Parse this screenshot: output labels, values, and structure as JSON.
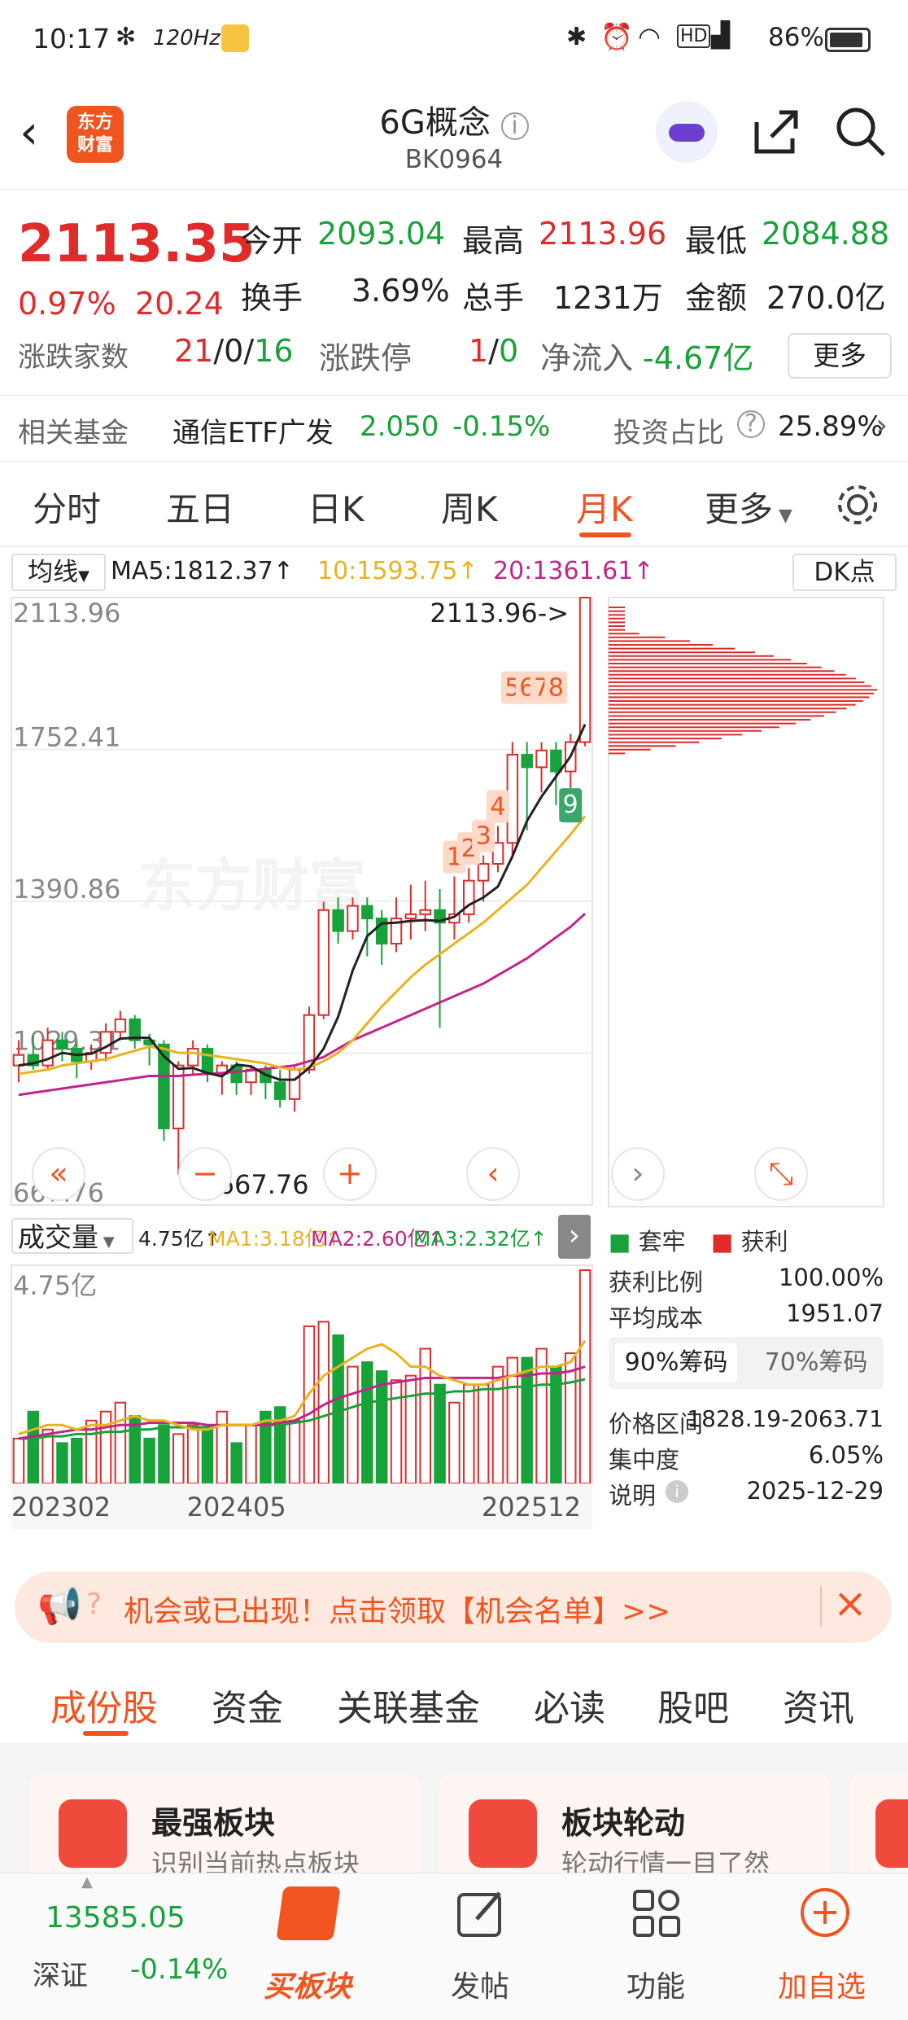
{
  "status_bar": {
    "time": "10:17",
    "extra": "120Hz",
    "battery": "86%"
  },
  "header": {
    "title": "6G概念",
    "code": "BK0964",
    "logo_line1": "东方",
    "logo_line2": "财富"
  },
  "quote": {
    "price": "2113.35",
    "change_pct": "0.97%",
    "change": "20.24",
    "open_label": "今开",
    "open": "2093.04",
    "high_label": "最高",
    "high": "2113.96",
    "low_label": "最低",
    "low": "2084.88",
    "turnover_label": "换手",
    "turnover": "3.69%",
    "volume_label": "总手",
    "volume": "1231万",
    "amount_label": "金额",
    "amount": "270.0亿",
    "updown_label": "涨跌家数",
    "up": "21",
    "flat": "0",
    "down": "16",
    "limit_label": "涨跌停",
    "limit_up": "1",
    "limit_down": "0",
    "netflow_label": "净流入",
    "netflow": "-4.67亿",
    "more": "更多"
  },
  "fund": {
    "label": "相关基金",
    "name": "通信ETF广发",
    "price": "2.050",
    "pct": "-0.15%",
    "ratio_label": "投资占比",
    "ratio": "25.89%"
  },
  "tabs": [
    "分时",
    "五日",
    "日K",
    "周K",
    "月K",
    "更多"
  ],
  "active_tab": "月K",
  "ma_line": {
    "type": "均线",
    "ma5": "MA5:1812.37",
    "ma10": "10:1593.75",
    "ma20": "20:1361.61",
    "dk": "DK点"
  },
  "colors": {
    "up": "#e02b2b",
    "down": "#18a23a",
    "ma5": "#222222",
    "ma10": "#e8b31e",
    "ma20": "#c2258a",
    "accent": "#f0541f"
  },
  "chart_data": {
    "type": "candlestick",
    "y_ticks": [
      "2113.96",
      "1752.41",
      "1390.86",
      "1029.31",
      "667.76"
    ],
    "ylim": [
      667.76,
      2113.96
    ],
    "max_label": "2113.96->",
    "min_label": "<-667.76",
    "markers": [
      "1",
      "2",
      "3",
      "4",
      "5",
      "6",
      "7",
      "8",
      "9"
    ],
    "x_ticks": [
      "202302",
      "202405",
      "202512"
    ],
    "candles": [
      [
        1000,
        1025,
        960,
        1060
      ],
      [
        1025,
        1000,
        990,
        1070
      ],
      [
        1000,
        1060,
        990,
        1090
      ],
      [
        1060,
        1040,
        1010,
        1080
      ],
      [
        1040,
        1010,
        970,
        1055
      ],
      [
        1010,
        1030,
        990,
        1050
      ],
      [
        1030,
        1080,
        1010,
        1100
      ],
      [
        1080,
        1110,
        1060,
        1130
      ],
      [
        1110,
        1060,
        1040,
        1120
      ],
      [
        1060,
        1050,
        1000,
        1075
      ],
      [
        1050,
        850,
        820,
        1060
      ],
      [
        850,
        1000,
        740,
        1010
      ],
      [
        1000,
        1040,
        980,
        1060
      ],
      [
        1040,
        980,
        960,
        1050
      ],
      [
        980,
        1000,
        930,
        1010
      ],
      [
        1000,
        960,
        930,
        1010
      ],
      [
        960,
        990,
        930,
        1000
      ],
      [
        990,
        960,
        920,
        1000
      ],
      [
        960,
        920,
        900,
        990
      ],
      [
        920,
        990,
        890,
        1000
      ],
      [
        990,
        1120,
        980,
        1140
      ],
      [
        1120,
        1370,
        1110,
        1390
      ],
      [
        1370,
        1320,
        1290,
        1400
      ],
      [
        1320,
        1380,
        1300,
        1400
      ],
      [
        1380,
        1350,
        1260,
        1400
      ],
      [
        1350,
        1290,
        1240,
        1370
      ],
      [
        1290,
        1350,
        1270,
        1400
      ],
      [
        1350,
        1360,
        1300,
        1430
      ],
      [
        1360,
        1370,
        1320,
        1440
      ],
      [
        1370,
        1340,
        1090,
        1420
      ],
      [
        1340,
        1360,
        1300,
        1450
      ],
      [
        1360,
        1440,
        1340,
        1470
      ],
      [
        1440,
        1480,
        1390,
        1500
      ],
      [
        1480,
        1530,
        1460,
        1570
      ],
      [
        1530,
        1740,
        1500,
        1770
      ],
      [
        1740,
        1710,
        1560,
        1770
      ],
      [
        1710,
        1750,
        1650,
        1770
      ],
      [
        1750,
        1700,
        1620,
        1770
      ],
      [
        1700,
        1770,
        1660,
        1790
      ],
      [
        1770,
        2113.96,
        1760,
        2113.96
      ]
    ],
    "ma5": [
      1000,
      1005,
      1015,
      1030,
      1025,
      1028,
      1044,
      1064,
      1066,
      1066,
      1022,
      992,
      994,
      982,
      974,
      1002,
      998,
      978,
      966,
      966,
      994,
      1040,
      1116,
      1226,
      1308,
      1338,
      1340,
      1344,
      1346,
      1344,
      1354,
      1382,
      1400,
      1426,
      1498,
      1582,
      1640,
      1688,
      1736,
      1812.37
    ],
    "ma10": [
      980,
      985,
      990,
      1000,
      1005,
      1010,
      1015,
      1025,
      1035,
      1045,
      1040,
      1030,
      1030,
      1025,
      1020,
      1015,
      1010,
      1005,
      995,
      990,
      995,
      1010,
      1030,
      1060,
      1100,
      1140,
      1175,
      1210,
      1240,
      1265,
      1290,
      1315,
      1340,
      1370,
      1400,
      1430,
      1470,
      1510,
      1550,
      1593.75
    ],
    "ma20": [
      930,
      935,
      940,
      945,
      950,
      955,
      960,
      965,
      970,
      975,
      975,
      975,
      978,
      980,
      982,
      985,
      988,
      992,
      996,
      1000,
      1010,
      1020,
      1040,
      1060,
      1075,
      1090,
      1105,
      1120,
      1135,
      1150,
      1165,
      1180,
      1195,
      1215,
      1235,
      1255,
      1280,
      1305,
      1330,
      1361.61
    ],
    "volume": {
      "label": "成交量",
      "max_label": "4.75亿",
      "ma_texts": [
        "4.75亿",
        "MA1:3.18亿",
        "MA2:2.60亿",
        "MA3:2.32亿"
      ],
      "values": [
        1.0,
        1.6,
        1.2,
        0.9,
        1.0,
        1.4,
        1.6,
        1.8,
        1.5,
        1.0,
        1.3,
        1.1,
        1.3,
        1.2,
        1.6,
        0.9,
        1.3,
        1.6,
        1.7,
        1.4,
        3.5,
        3.6,
        3.3,
        2.6,
        2.7,
        2.5,
        2.3,
        2.4,
        3.0,
        2.2,
        1.8,
        2.2,
        2.2,
        2.6,
        2.8,
        2.8,
        3.0,
        2.6,
        2.9,
        4.75
      ],
      "ma1": [
        1.1,
        1.2,
        1.3,
        1.3,
        1.2,
        1.3,
        1.3,
        1.4,
        1.5,
        1.4,
        1.4,
        1.3,
        1.2,
        1.2,
        1.3,
        1.3,
        1.3,
        1.4,
        1.4,
        1.5,
        2.0,
        2.4,
        2.6,
        2.8,
        3.0,
        3.1,
        2.9,
        2.6,
        2.6,
        2.4,
        2.3,
        2.2,
        2.2,
        2.3,
        2.4,
        2.5,
        2.6,
        2.6,
        2.7,
        3.18
      ],
      "ma2": [
        1.0,
        1.05,
        1.1,
        1.15,
        1.2,
        1.2,
        1.25,
        1.3,
        1.3,
        1.35,
        1.35,
        1.35,
        1.35,
        1.3,
        1.3,
        1.3,
        1.3,
        1.3,
        1.35,
        1.4,
        1.55,
        1.75,
        1.9,
        2.0,
        2.1,
        2.2,
        2.25,
        2.3,
        2.35,
        2.35,
        2.35,
        2.35,
        2.35,
        2.35,
        2.4,
        2.4,
        2.45,
        2.45,
        2.5,
        2.6
      ],
      "ma3": [
        1.0,
        1.0,
        1.05,
        1.05,
        1.1,
        1.1,
        1.15,
        1.15,
        1.2,
        1.2,
        1.25,
        1.25,
        1.25,
        1.25,
        1.3,
        1.3,
        1.3,
        1.3,
        1.3,
        1.35,
        1.4,
        1.5,
        1.6,
        1.7,
        1.8,
        1.85,
        1.9,
        1.95,
        2.0,
        2.0,
        2.05,
        2.05,
        2.1,
        2.1,
        2.15,
        2.15,
        2.2,
        2.2,
        2.25,
        2.32
      ]
    },
    "chips": {
      "legend_trap": "套牢",
      "legend_profit": "获利"
    }
  },
  "chip_info": {
    "profit_ratio_label": "获利比例",
    "profit_ratio": "100.00%",
    "avg_cost_label": "平均成本",
    "avg_cost": "1951.07",
    "tab90": "90%筹码",
    "tab70": "70%筹码",
    "range_label": "价格区间",
    "range": "1828.19-2063.71",
    "concentration_label": "集中度",
    "concentration": "6.05%",
    "note_label": "说明",
    "note_date": "2025-12-29"
  },
  "banner": {
    "text": "机会或已出现！点击领取【机会名单】>>"
  },
  "sub_tabs": [
    "成份股",
    "资金",
    "关联基金",
    "必读",
    "股吧",
    "资讯"
  ],
  "cards": [
    {
      "title": "最强板块",
      "desc": "识别当前热点板块"
    },
    {
      "title": "板块轮动",
      "desc": "轮动行情一目了然"
    }
  ],
  "bottom_bar": {
    "index_value": "13585.05",
    "index_name": "深证",
    "index_pct": "-0.14%",
    "items": [
      "买板块",
      "发帖",
      "功能",
      "加自选"
    ]
  }
}
